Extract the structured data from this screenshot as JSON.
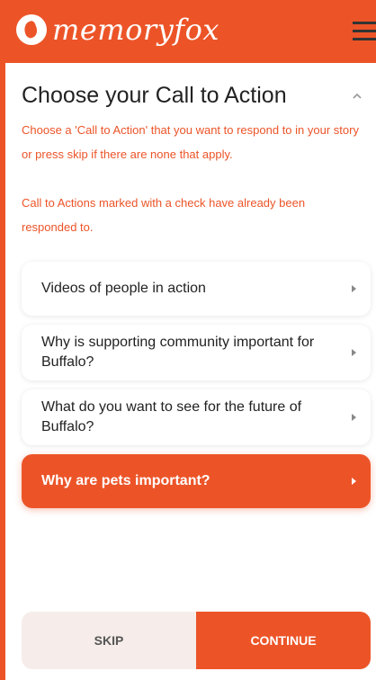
{
  "header": {
    "logo_text": "memoryfox",
    "logo_icon": "fox-logo-icon",
    "menu_icon": "hamburger-menu-icon"
  },
  "panel": {
    "title": "Choose your Call to Action",
    "collapse_icon": "chevron-up-icon",
    "intro_line1": "Choose a 'Call to Action' that you want to respond to in your story or press skip if there are none that apply.",
    "intro_line2": "Call to Actions marked with a check have already been responded to."
  },
  "actions": [
    {
      "label": "Videos of people in action",
      "selected": false
    },
    {
      "label": "Why is supporting community important for Buffalo?",
      "selected": false
    },
    {
      "label": "What do you want to see for the future of Buffalo?",
      "selected": false
    },
    {
      "label": "Why are pets important?",
      "selected": true
    }
  ],
  "footer": {
    "skip_label": "SKIP",
    "continue_label": "CONTINUE"
  },
  "colors": {
    "accent": "#EC5428",
    "skip_bg": "#F6EDEA"
  }
}
